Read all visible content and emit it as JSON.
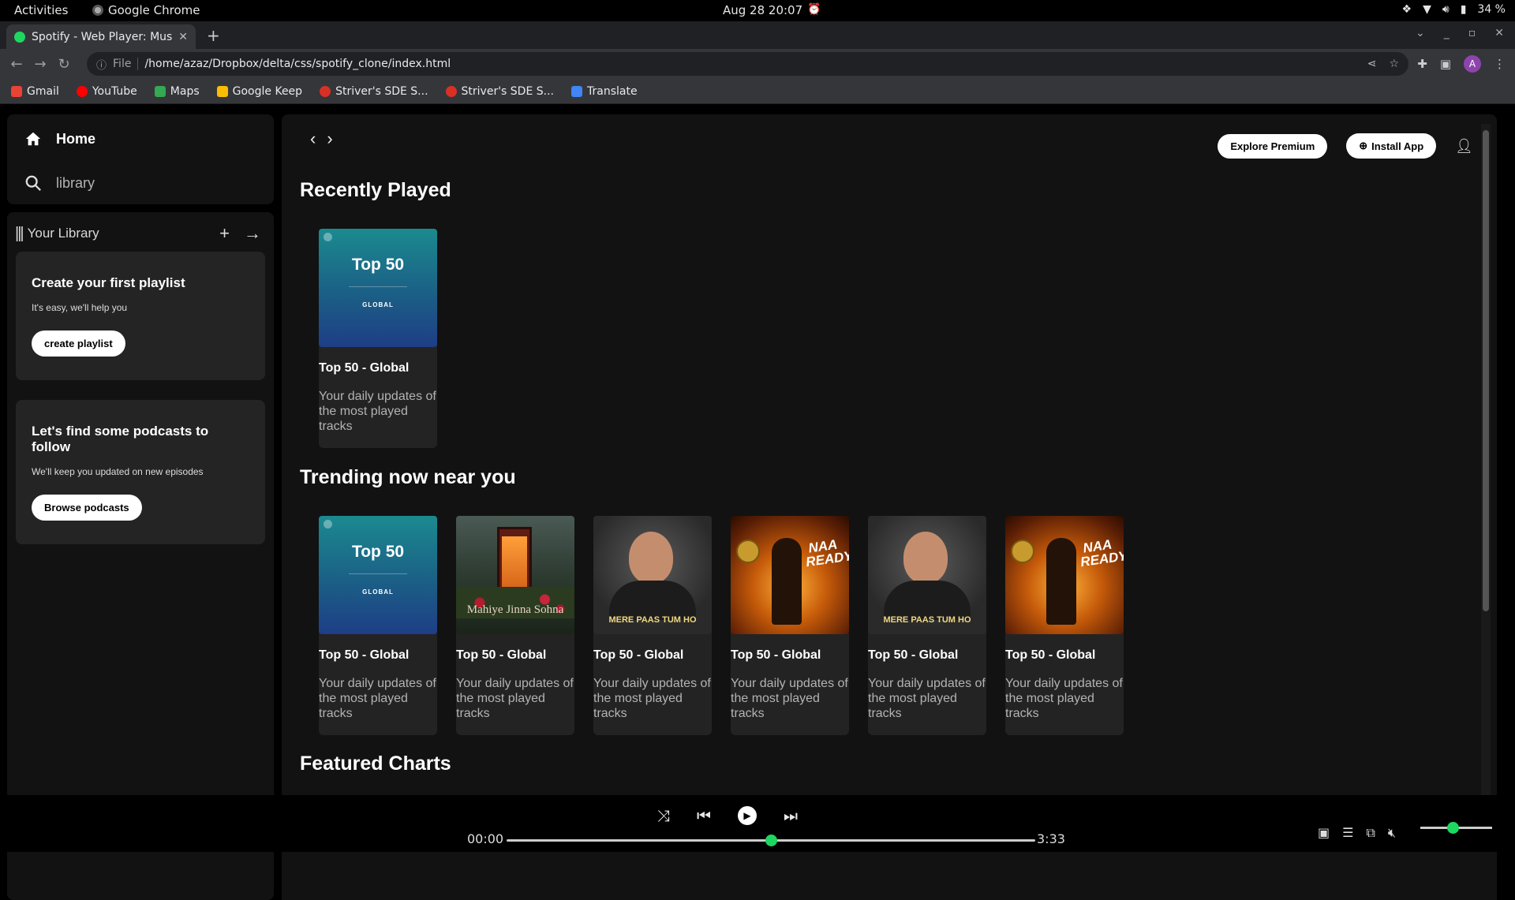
{
  "system_bar": {
    "activities": "Activities",
    "app_name": "Google Chrome",
    "clock": "Aug 28  20:07",
    "battery": "34 %"
  },
  "browser": {
    "tab_title": "Spotify - Web Player: Musi",
    "url_scheme_label": "File",
    "url": "/home/azaz/Dropbox/delta/css/spotify_clone/index.html",
    "profile_initial": "A",
    "bookmarks": [
      {
        "label": "Gmail",
        "color": "#ea4335"
      },
      {
        "label": "YouTube",
        "color": "#ff0000"
      },
      {
        "label": "Maps",
        "color": "#34a853"
      },
      {
        "label": "Google Keep",
        "color": "#fbbc04"
      },
      {
        "label": "Striver's SDE S...",
        "color": "#d93025"
      },
      {
        "label": "Striver's SDE S...",
        "color": "#d93025"
      },
      {
        "label": "Translate",
        "color": "#4285f4"
      }
    ]
  },
  "sidebar": {
    "home_label": "Home",
    "search_label": "library",
    "library_label": "Your Library",
    "playlist_card": {
      "title": "Create your first playlist",
      "subtitle": "It's easy, we'll help you",
      "button": "create playlist"
    },
    "podcast_card": {
      "title": "Let's find some podcasts to follow",
      "subtitle": "We'll keep you updated on new episodes",
      "button": "Browse podcasts"
    }
  },
  "header": {
    "explore_premium": "Explore Premium",
    "install_app": "Install App"
  },
  "sections": {
    "recently_played": "Recently Played",
    "trending": "Trending now near you",
    "featured": "Featured Charts"
  },
  "recent_cards": [
    {
      "cover": "top50",
      "cover_title": "Top 50",
      "cover_sub": "GLOBAL",
      "title": "Top 50 - Global",
      "desc": "Your daily updates of the most played tracks"
    }
  ],
  "trending_cards": [
    {
      "cover": "top50",
      "cover_title": "Top 50",
      "cover_sub": "GLOBAL",
      "title": "Top 50 - Global",
      "desc": "Your daily updates of the most played tracks"
    },
    {
      "cover": "booth",
      "cover_title": "Mahiye Jinna Sohna",
      "title": "Top 50 - Global",
      "desc": "Your daily updates of the most played tracks"
    },
    {
      "cover": "singer",
      "cover_title": "MERE PAAS TUM HO",
      "title": "Top 50 - Global",
      "desc": "Your daily updates of the most played tracks"
    },
    {
      "cover": "fire",
      "cover_title": "NAA READY",
      "title": "Top 50 - Global",
      "desc": "Your daily updates of the most played tracks"
    },
    {
      "cover": "singer",
      "cover_title": "MERE PAAS TUM HO",
      "title": "Top 50 - Global",
      "desc": "Your daily updates of the most played tracks"
    },
    {
      "cover": "fire",
      "cover_title": "NAA READY",
      "title": "Top 50 - Global",
      "desc": "Your daily updates of the most played tracks"
    }
  ],
  "player": {
    "current_time": "00:00",
    "total_time": "3:33",
    "progress_fraction": 0.5,
    "volume_fraction": 0.45
  },
  "colors": {
    "accent": "#1ed760",
    "panel": "#121212",
    "card": "#242424"
  }
}
